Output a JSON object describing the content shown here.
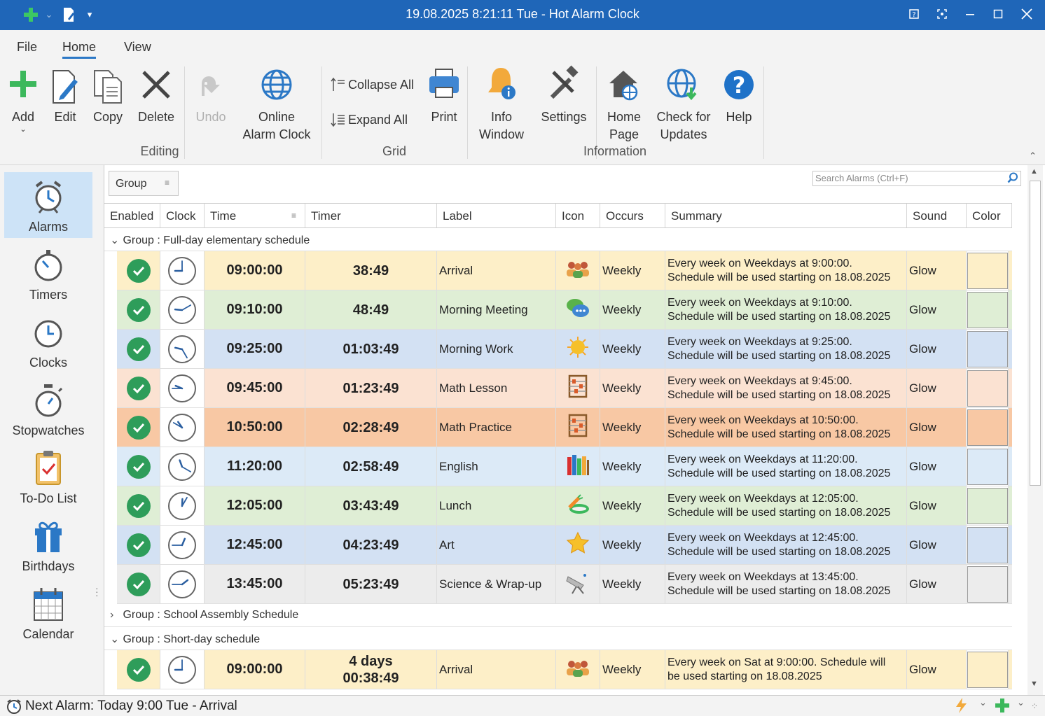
{
  "window": {
    "title": "19.08.2025 8:21:11 Tue - Hot Alarm Clock"
  },
  "menu": {
    "file": "File",
    "home": "Home",
    "view": "View"
  },
  "ribbon": {
    "add": "Add",
    "edit": "Edit",
    "copy": "Copy",
    "delete": "Delete",
    "undo": "Undo",
    "online1": "Online",
    "online2": "Alarm Clock",
    "collapse_all": "Collapse All",
    "expand_all": "Expand All",
    "print": "Print",
    "info1": "Info",
    "info2": "Window",
    "settings": "Settings",
    "home1": "Home",
    "home2": "Page",
    "check1": "Check for",
    "check2": "Updates",
    "help": "Help",
    "group_editing": "Editing",
    "group_grid": "Grid",
    "group_information": "Information"
  },
  "sidebar": {
    "alarms": "Alarms",
    "timers": "Timers",
    "clocks": "Clocks",
    "stopwatches": "Stopwatches",
    "todo": "To-Do List",
    "birthdays": "Birthdays",
    "calendar": "Calendar"
  },
  "grid": {
    "group_chip": "Group",
    "search_placeholder": "Search Alarms (Ctrl+F)",
    "columns": {
      "enabled": "Enabled",
      "clock": "Clock",
      "time": "Time",
      "timer": "Timer",
      "label": "Label",
      "icon": "Icon",
      "occurs": "Occurs",
      "summary": "Summary",
      "sound": "Sound",
      "color": "Color"
    },
    "groups": [
      {
        "title": "Group : Full-day elementary schedule"
      },
      {
        "title": "Group : School Assembly Schedule"
      },
      {
        "title": "Group : Short-day schedule"
      }
    ],
    "rows": [
      {
        "time": "09:00:00",
        "timer": "38:49",
        "label": "Arrival",
        "icon": "people-icon",
        "occurs": "Weekly",
        "summary1": "Every week on Weekdays at 9:00:00.",
        "summary2": "Schedule will be used starting on 18.08.2025",
        "sound": "Glow",
        "color": "#fdefc8"
      },
      {
        "time": "09:10:00",
        "timer": "48:49",
        "label": "Morning Meeting",
        "icon": "chat-icon",
        "occurs": "Weekly",
        "summary1": "Every week on Weekdays at 9:10:00.",
        "summary2": "Schedule will be used starting on 18.08.2025",
        "sound": "Glow",
        "color": "#dfeed5"
      },
      {
        "time": "09:25:00",
        "timer": "01:03:49",
        "label": "Morning Work",
        "icon": "sun-icon",
        "occurs": "Weekly",
        "summary1": "Every week on Weekdays at 9:25:00.",
        "summary2": "Schedule will be used starting on 18.08.2025",
        "sound": "Glow",
        "color": "#d3e1f3"
      },
      {
        "time": "09:45:00",
        "timer": "01:23:49",
        "label": "Math Lesson",
        "icon": "abacus-icon",
        "occurs": "Weekly",
        "summary1": "Every week on Weekdays at 9:45:00.",
        "summary2": "Schedule will be used starting on 18.08.2025",
        "sound": "Glow",
        "color": "#fbe2d2"
      },
      {
        "time": "10:50:00",
        "timer": "02:28:49",
        "label": "Math Practice",
        "icon": "abacus-icon",
        "occurs": "Weekly",
        "summary1": "Every week on Weekdays at 10:50:00.",
        "summary2": "Schedule will be used starting on 18.08.2025",
        "sound": "Glow",
        "color": "#f8c8a4"
      },
      {
        "time": "11:20:00",
        "timer": "02:58:49",
        "label": "English",
        "icon": "books-icon",
        "occurs": "Weekly",
        "summary1": "Every week on Weekdays at 11:20:00.",
        "summary2": "Schedule will be used starting on 18.08.2025",
        "sound": "Glow",
        "color": "#dceaf7"
      },
      {
        "time": "12:05:00",
        "timer": "03:43:49",
        "label": "Lunch",
        "icon": "food-icon",
        "occurs": "Weekly",
        "summary1": "Every week on Weekdays at 12:05:00.",
        "summary2": "Schedule will be used starting on 18.08.2025",
        "sound": "Glow",
        "color": "#dfeed5"
      },
      {
        "time": "12:45:00",
        "timer": "04:23:49",
        "label": "Art",
        "icon": "star-icon",
        "occurs": "Weekly",
        "summary1": "Every week on Weekdays at 12:45:00.",
        "summary2": "Schedule will be used starting on 18.08.2025",
        "sound": "Glow",
        "color": "#d3e1f3"
      },
      {
        "time": "13:45:00",
        "timer": "05:23:49",
        "label": "Science & Wrap-up",
        "icon": "telescope-icon",
        "occurs": "Weekly",
        "summary1": "Every week on Weekdays at 13:45:00.",
        "summary2": "Schedule will be used starting on 18.08.2025",
        "sound": "Glow",
        "color": "#ececec"
      }
    ],
    "short_rows": [
      {
        "time": "09:00:00",
        "timer1": "4 days",
        "timer2": "00:38:49",
        "label": "Arrival",
        "icon": "people-icon",
        "occurs": "Weekly",
        "summary1": "Every week on Sat at 9:00:00. Schedule will",
        "summary2": "be used starting on 18.08.2025",
        "sound": "Glow",
        "color": "#fdefc8"
      }
    ]
  },
  "status": {
    "next_alarm": "Next Alarm: Today 9:00 Tue - Arrival"
  }
}
